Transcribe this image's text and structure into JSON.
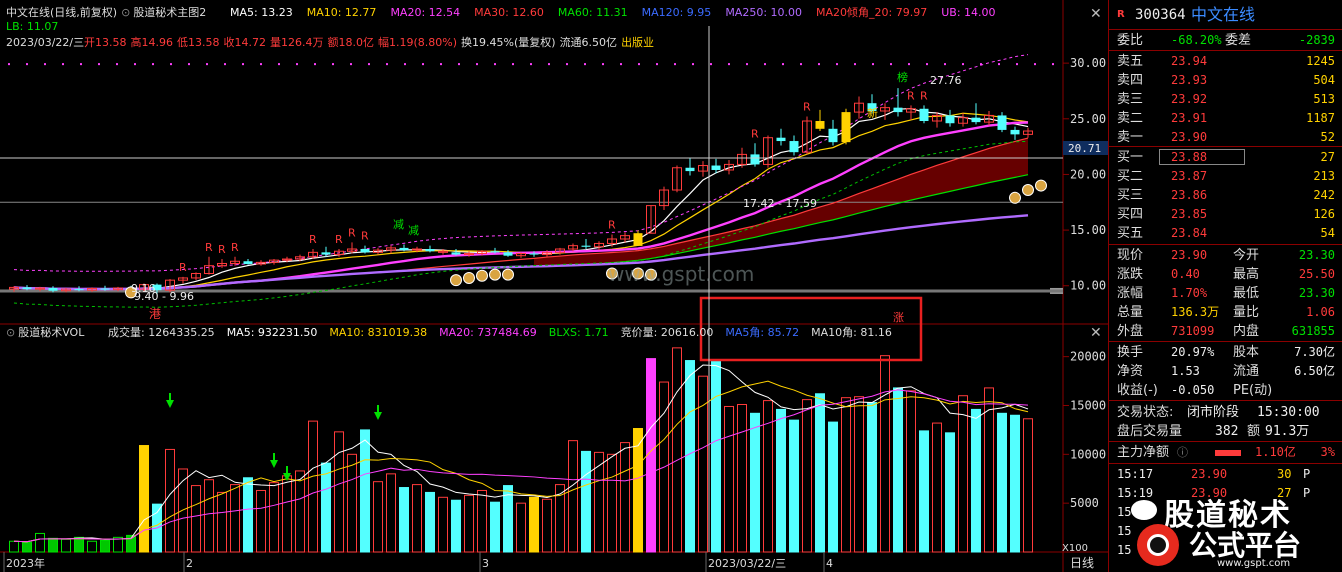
{
  "header": {
    "title": "中文在线(日线,前复权)",
    "indicator_name": "股道秘术主图2",
    "ma_items": [
      {
        "label": "MA5: 13.23",
        "color": "#ffffff"
      },
      {
        "label": "MA10: 12.77",
        "color": "#ffd200"
      },
      {
        "label": "MA20: 12.54",
        "color": "#ff40ff"
      },
      {
        "label": "MA30: 12.60",
        "color": "#ff3b3b"
      },
      {
        "label": "MA60: 11.31",
        "color": "#00e000"
      },
      {
        "label": "MA120: 9.95",
        "color": "#3b6bff"
      },
      {
        "label": "MA250: 10.00",
        "color": "#b06bff"
      },
      {
        "label": "MA20倾角_20: 79.97",
        "color": "#ff3b3b"
      },
      {
        "label": "UB: 14.00",
        "color": "#ff40ff"
      }
    ],
    "lb": "LB: 11.07",
    "date_line": "2023/03/22/三",
    "ohlc_items": [
      {
        "label": "开13.58",
        "color": "#ff3b3b"
      },
      {
        "label": "高14.96",
        "color": "#ff3b3b"
      },
      {
        "label": "低13.58",
        "color": "#ff3b3b"
      },
      {
        "label": "收14.72",
        "color": "#ff3b3b"
      },
      {
        "label": "量126.4万",
        "color": "#ff3b3b"
      },
      {
        "label": "额18.0亿",
        "color": "#ff3b3b"
      },
      {
        "label": "幅1.19(8.80%)",
        "color": "#ff3b3b"
      },
      {
        "label": "换19.45%(量复权)",
        "color": "#dddddd"
      },
      {
        "label": "流通6.50亿",
        "color": "#dddddd"
      },
      {
        "label": "出版业",
        "color": "#ffd200"
      }
    ]
  },
  "volume_header": {
    "name": "股道秘术VOL",
    "items": [
      {
        "label": "成交量: 1264335.25",
        "color": "#dddddd"
      },
      {
        "label": "MA5: 932231.50",
        "color": "#ffffff"
      },
      {
        "label": "MA10: 831019.38",
        "color": "#ffd200"
      },
      {
        "label": "MA20: 737484.69",
        "color": "#ff40ff"
      },
      {
        "label": "BLXS: 1.71",
        "color": "#00e000"
      },
      {
        "label": "竞价量: 20616.00",
        "color": "#dddddd"
      },
      {
        "label": "MA5角: 85.72",
        "color": "#3b6bff"
      },
      {
        "label": "MA10角: 81.16",
        "color": "#dddddd"
      }
    ]
  },
  "annotations": {
    "crosshair_price": "20.71",
    "high_label": "27.76",
    "low_label": "9.16",
    "range_label_low": "9.40 - 9.96",
    "range_label_mid": "17.42 - 17.59",
    "r_mark": "R",
    "reduce_mark": "减",
    "gang_mark": "港",
    "zhang_mark": "涨",
    "bang_mark": "榜",
    "xin_mark": "新",
    "watermark": "www.gspt.com"
  },
  "x_axis": {
    "labels": [
      "2023年",
      "2",
      "3",
      "2023/03/22/三",
      "4"
    ],
    "right_label": "日线",
    "vol_unit": "X100"
  },
  "chart_data": {
    "type": "candlestick",
    "price_axis": {
      "ticks": [
        10.0,
        15.0,
        20.0,
        25.0,
        30.0
      ],
      "ylim": [
        8.0,
        31.0
      ]
    },
    "volume_axis": {
      "ticks": [
        5000,
        10000,
        15000,
        20000
      ],
      "ylim": [
        0,
        21500
      ]
    },
    "candles": [
      {
        "o": 9.7,
        "h": 9.95,
        "l": 9.45,
        "c": 9.85,
        "up": true,
        "v": 1100
      },
      {
        "o": 9.85,
        "h": 10.05,
        "l": 9.6,
        "c": 9.7,
        "up": false,
        "v": 1000
      },
      {
        "o": 9.7,
        "h": 9.9,
        "l": 9.5,
        "c": 9.8,
        "up": true,
        "v": 1900
      },
      {
        "o": 9.8,
        "h": 9.95,
        "l": 9.4,
        "c": 9.55,
        "up": false,
        "v": 1400
      },
      {
        "o": 9.55,
        "h": 9.8,
        "l": 9.4,
        "c": 9.7,
        "up": true,
        "v": 1300
      },
      {
        "o": 9.7,
        "h": 9.95,
        "l": 9.5,
        "c": 9.6,
        "up": false,
        "v": 1500
      },
      {
        "o": 9.6,
        "h": 9.85,
        "l": 9.45,
        "c": 9.75,
        "up": true,
        "v": 1100
      },
      {
        "o": 9.75,
        "h": 10.0,
        "l": 9.55,
        "c": 9.65,
        "up": false,
        "v": 1200
      },
      {
        "o": 9.65,
        "h": 9.9,
        "l": 9.5,
        "c": 9.8,
        "up": true,
        "v": 1500
      },
      {
        "o": 9.8,
        "h": 10.0,
        "l": 9.6,
        "c": 9.7,
        "up": false,
        "v": 1700
      },
      {
        "o": 9.7,
        "h": 10.2,
        "l": 9.5,
        "c": 10.1,
        "up": true,
        "v": 10900
      },
      {
        "o": 10.1,
        "h": 10.2,
        "l": 9.16,
        "c": 9.6,
        "up": false,
        "v": 4900
      },
      {
        "o": 9.6,
        "h": 10.6,
        "l": 9.4,
        "c": 10.5,
        "up": true,
        "v": 10500
      },
      {
        "o": 10.5,
        "h": 10.8,
        "l": 10.2,
        "c": 10.7,
        "up": true,
        "v": 8500
      },
      {
        "o": 10.7,
        "h": 11.2,
        "l": 10.5,
        "c": 11.1,
        "up": true,
        "v": 6800
      },
      {
        "o": 11.1,
        "h": 12.6,
        "l": 11.0,
        "c": 11.8,
        "up": true,
        "v": 7400
      },
      {
        "o": 11.8,
        "h": 12.4,
        "l": 11.6,
        "c": 12.0,
        "up": true,
        "v": 6100
      },
      {
        "o": 12.0,
        "h": 12.6,
        "l": 11.8,
        "c": 12.2,
        "up": true,
        "v": 6900
      },
      {
        "o": 12.2,
        "h": 12.4,
        "l": 11.9,
        "c": 11.95,
        "up": false,
        "v": 7600
      },
      {
        "o": 11.95,
        "h": 12.3,
        "l": 11.8,
        "c": 12.1,
        "up": true,
        "v": 6300
      },
      {
        "o": 12.1,
        "h": 12.4,
        "l": 11.9,
        "c": 12.3,
        "up": true,
        "v": 7100
      },
      {
        "o": 12.3,
        "h": 12.6,
        "l": 12.1,
        "c": 12.4,
        "up": true,
        "v": 7800
      },
      {
        "o": 12.4,
        "h": 12.8,
        "l": 12.2,
        "c": 12.6,
        "up": true,
        "v": 8300
      },
      {
        "o": 12.6,
        "h": 13.3,
        "l": 12.4,
        "c": 13.0,
        "up": true,
        "v": 13400
      },
      {
        "o": 13.0,
        "h": 13.5,
        "l": 12.6,
        "c": 12.8,
        "up": false,
        "v": 9100
      },
      {
        "o": 12.8,
        "h": 13.3,
        "l": 12.6,
        "c": 13.1,
        "up": true,
        "v": 12300
      },
      {
        "o": 13.1,
        "h": 13.9,
        "l": 12.9,
        "c": 13.3,
        "up": true,
        "v": 10000
      },
      {
        "o": 13.3,
        "h": 13.6,
        "l": 12.9,
        "c": 13.0,
        "up": false,
        "v": 12500
      },
      {
        "o": 13.0,
        "h": 13.4,
        "l": 12.8,
        "c": 13.2,
        "up": true,
        "v": 7200
      },
      {
        "o": 13.2,
        "h": 13.6,
        "l": 12.9,
        "c": 13.4,
        "up": true,
        "v": 8000
      },
      {
        "o": 13.4,
        "h": 13.7,
        "l": 13.1,
        "c": 13.2,
        "up": false,
        "v": 6600
      },
      {
        "o": 13.2,
        "h": 13.5,
        "l": 13.0,
        "c": 13.3,
        "up": true,
        "v": 6900
      },
      {
        "o": 13.3,
        "h": 13.6,
        "l": 13.0,
        "c": 13.1,
        "up": false,
        "v": 6100
      },
      {
        "o": 13.1,
        "h": 13.3,
        "l": 12.8,
        "c": 13.0,
        "up": true,
        "v": 5600
      },
      {
        "o": 13.0,
        "h": 13.3,
        "l": 12.7,
        "c": 12.8,
        "up": false,
        "v": 5300
      },
      {
        "o": 12.8,
        "h": 13.1,
        "l": 12.6,
        "c": 12.9,
        "up": true,
        "v": 5800
      },
      {
        "o": 12.9,
        "h": 13.2,
        "l": 12.7,
        "c": 13.1,
        "up": true,
        "v": 6300
      },
      {
        "o": 13.1,
        "h": 13.4,
        "l": 12.9,
        "c": 13.0,
        "up": false,
        "v": 5100
      },
      {
        "o": 13.0,
        "h": 13.2,
        "l": 12.6,
        "c": 12.7,
        "up": false,
        "v": 6800
      },
      {
        "o": 12.7,
        "h": 13.0,
        "l": 12.5,
        "c": 12.9,
        "up": true,
        "v": 5000
      },
      {
        "o": 12.9,
        "h": 13.1,
        "l": 12.6,
        "c": 12.8,
        "up": false,
        "v": 5600
      },
      {
        "o": 12.8,
        "h": 13.2,
        "l": 12.6,
        "c": 13.0,
        "up": true,
        "v": 5400
      },
      {
        "o": 13.0,
        "h": 13.4,
        "l": 12.8,
        "c": 13.3,
        "up": true,
        "v": 6900
      },
      {
        "o": 13.3,
        "h": 13.8,
        "l": 13.1,
        "c": 13.6,
        "up": true,
        "v": 11400
      },
      {
        "o": 13.6,
        "h": 14.2,
        "l": 13.3,
        "c": 13.5,
        "up": false,
        "v": 10300
      },
      {
        "o": 13.5,
        "h": 14.0,
        "l": 13.2,
        "c": 13.8,
        "up": true,
        "v": 10200
      },
      {
        "o": 13.8,
        "h": 14.6,
        "l": 13.5,
        "c": 14.2,
        "up": true,
        "v": 10000
      },
      {
        "o": 14.2,
        "h": 14.8,
        "l": 13.9,
        "c": 14.5,
        "up": true,
        "v": 11200
      },
      {
        "o": 13.58,
        "h": 14.96,
        "l": 13.58,
        "c": 14.72,
        "up": true,
        "v": 12643
      },
      {
        "o": 14.72,
        "h": 17.2,
        "l": 14.7,
        "c": 17.2,
        "up": true,
        "v": 19800
      },
      {
        "o": 17.2,
        "h": 18.9,
        "l": 16.8,
        "c": 18.6,
        "up": true,
        "v": 17400
      },
      {
        "o": 18.6,
        "h": 20.8,
        "l": 18.4,
        "c": 20.6,
        "up": true,
        "v": 20900
      },
      {
        "o": 20.6,
        "h": 21.5,
        "l": 19.9,
        "c": 20.3,
        "up": false,
        "v": 19600
      },
      {
        "o": 20.3,
        "h": 21.2,
        "l": 19.8,
        "c": 20.8,
        "up": true,
        "v": 18000
      },
      {
        "o": 20.8,
        "h": 21.4,
        "l": 20.1,
        "c": 20.4,
        "up": false,
        "v": 19500
      },
      {
        "o": 20.4,
        "h": 21.3,
        "l": 20.0,
        "c": 20.9,
        "up": true,
        "v": 14900
      },
      {
        "o": 20.9,
        "h": 22.4,
        "l": 20.6,
        "c": 21.8,
        "up": true,
        "v": 15100
      },
      {
        "o": 21.8,
        "h": 22.8,
        "l": 20.7,
        "c": 20.9,
        "up": false,
        "v": 14200
      },
      {
        "o": 20.9,
        "h": 23.5,
        "l": 20.6,
        "c": 23.3,
        "up": true,
        "v": 15500
      },
      {
        "o": 23.3,
        "h": 24.1,
        "l": 22.6,
        "c": 23.0,
        "up": false,
        "v": 14600
      },
      {
        "o": 23.0,
        "h": 23.5,
        "l": 21.7,
        "c": 22.0,
        "up": false,
        "v": 13500
      },
      {
        "o": 22.0,
        "h": 25.2,
        "l": 21.8,
        "c": 24.8,
        "up": true,
        "v": 15600
      },
      {
        "o": 24.8,
        "h": 25.8,
        "l": 23.9,
        "c": 24.1,
        "up": false,
        "v": 16200
      },
      {
        "o": 24.1,
        "h": 24.9,
        "l": 22.6,
        "c": 22.9,
        "up": false,
        "v": 13300
      },
      {
        "o": 22.9,
        "h": 25.9,
        "l": 22.7,
        "c": 25.6,
        "up": true,
        "v": 15800
      },
      {
        "o": 25.6,
        "h": 27.0,
        "l": 25.0,
        "c": 26.4,
        "up": true,
        "v": 15900
      },
      {
        "o": 26.4,
        "h": 27.2,
        "l": 25.5,
        "c": 25.7,
        "up": false,
        "v": 15300
      },
      {
        "o": 25.7,
        "h": 26.4,
        "l": 24.9,
        "c": 26.0,
        "up": true,
        "v": 20100
      },
      {
        "o": 26.0,
        "h": 27.76,
        "l": 25.2,
        "c": 25.6,
        "up": false,
        "v": 16800
      },
      {
        "o": 25.6,
        "h": 26.2,
        "l": 24.9,
        "c": 25.9,
        "up": true,
        "v": 16500
      },
      {
        "o": 25.9,
        "h": 26.2,
        "l": 24.6,
        "c": 24.8,
        "up": false,
        "v": 12400
      },
      {
        "o": 24.8,
        "h": 25.6,
        "l": 24.2,
        "c": 25.3,
        "up": true,
        "v": 13200
      },
      {
        "o": 25.3,
        "h": 25.8,
        "l": 24.3,
        "c": 24.6,
        "up": false,
        "v": 12200
      },
      {
        "o": 24.6,
        "h": 25.5,
        "l": 24.3,
        "c": 25.1,
        "up": true,
        "v": 16000
      },
      {
        "o": 25.1,
        "h": 26.4,
        "l": 24.5,
        "c": 24.7,
        "up": false,
        "v": 14600
      },
      {
        "o": 24.7,
        "h": 25.7,
        "l": 24.4,
        "c": 25.3,
        "up": true,
        "v": 16800
      },
      {
        "o": 25.3,
        "h": 25.6,
        "l": 23.8,
        "c": 24.0,
        "up": false,
        "v": 14200
      },
      {
        "o": 24.0,
        "h": 24.3,
        "l": 23.1,
        "c": 23.6,
        "up": false,
        "v": 14000
      },
      {
        "o": 23.6,
        "h": 24.2,
        "l": 23.3,
        "c": 23.9,
        "up": true,
        "v": 13640
      }
    ],
    "ma_lines": [
      {
        "name": "MA5",
        "color": "#ffffff"
      },
      {
        "name": "MA10",
        "color": "#ffd200"
      },
      {
        "name": "MA20",
        "color": "#ff40ff"
      },
      {
        "name": "MA30",
        "color": "#ff3b3b"
      },
      {
        "name": "MA60",
        "color": "#00e000"
      },
      {
        "name": "MA250",
        "color": "#b06bff"
      }
    ]
  },
  "sidebar": {
    "code": "300364",
    "name": "中文在线",
    "r_badge": "R",
    "webi": {
      "label": "委比",
      "value": "-68.20%",
      "label2": "委差",
      "value2": "-2839"
    },
    "sells": [
      {
        "label": "卖五",
        "price": "23.94",
        "vol": "1245"
      },
      {
        "label": "卖四",
        "price": "23.93",
        "vol": "504"
      },
      {
        "label": "卖三",
        "price": "23.92",
        "vol": "513"
      },
      {
        "label": "卖二",
        "price": "23.91",
        "vol": "1187"
      },
      {
        "label": "卖一",
        "price": "23.90",
        "vol": "52"
      }
    ],
    "buys": [
      {
        "label": "买一",
        "price": "23.88",
        "vol": "27"
      },
      {
        "label": "买二",
        "price": "23.87",
        "vol": "213"
      },
      {
        "label": "买三",
        "price": "23.86",
        "vol": "242"
      },
      {
        "label": "买四",
        "price": "23.85",
        "vol": "126"
      },
      {
        "label": "买五",
        "price": "23.84",
        "vol": "54"
      }
    ],
    "stats": [
      {
        "l1": "现价",
        "v1": "23.90",
        "c1": "red",
        "l2": "今开",
        "v2": "23.30",
        "c2": "green"
      },
      {
        "l1": "涨跌",
        "v1": "0.40",
        "c1": "red",
        "l2": "最高",
        "v2": "25.50",
        "c2": "red"
      },
      {
        "l1": "涨幅",
        "v1": "1.70%",
        "c1": "red",
        "l2": "最低",
        "v2": "23.30",
        "c2": "green"
      },
      {
        "l1": "总量",
        "v1": "136.3万",
        "c1": "yellow",
        "l2": "量比",
        "v2": "1.06",
        "c2": "red"
      },
      {
        "l1": "外盘",
        "v1": "731099",
        "c1": "red",
        "l2": "内盘",
        "v2": "631855",
        "c2": "green"
      }
    ],
    "stats2": [
      {
        "l1": "换手",
        "v1": "20.97%",
        "c1": "white",
        "l2": "股本",
        "v2": "7.30亿",
        "c2": "white"
      },
      {
        "l1": "净资",
        "v1": "1.53",
        "c1": "white",
        "l2": "流通",
        "v2": "6.50亿",
        "c2": "white"
      },
      {
        "l1": "收益(-)",
        "v1": "-0.050",
        "c1": "white",
        "l2": "PE(动)",
        "v2": "",
        "c2": "white"
      }
    ],
    "trade_status": {
      "label": "交易状态:",
      "value": "闭市阶段",
      "time": "15:30:00"
    },
    "after_hours": {
      "label": "盘后交易量",
      "vol": "382",
      "amount_label": "额",
      "amount": "91.3万"
    },
    "main_flow": {
      "label": "主力净额",
      "value": "1.10亿",
      "pct": "3%"
    },
    "ticks": [
      {
        "time": "15:17",
        "price": "23.90",
        "vol": "30",
        "side": "P"
      },
      {
        "time": "15:19",
        "price": "23.90",
        "vol": "27",
        "side": "P"
      },
      {
        "time": "15",
        "price": "",
        "vol": "",
        "side": ""
      },
      {
        "time": "15",
        "price": "",
        "vol": "",
        "side": ""
      },
      {
        "time": "15",
        "price": "",
        "vol": "",
        "side": ""
      }
    ],
    "logo_text": "公式平台",
    "logo_url": "www.gspt.com",
    "wechat_text": "股道秘术"
  }
}
